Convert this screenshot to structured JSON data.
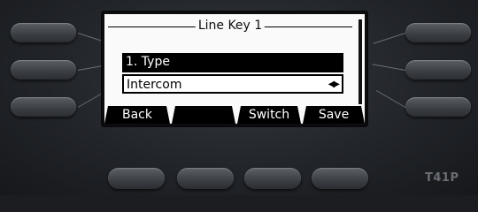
{
  "screen": {
    "title": "Line Key 1",
    "field_label": "1. Type",
    "field_value": "Intercom",
    "value_arrows": "◀▶"
  },
  "softkeys": [
    {
      "label": "Back"
    },
    {
      "label": ""
    },
    {
      "label": "Switch"
    },
    {
      "label": "Save"
    }
  ],
  "device": {
    "model": "T41P"
  }
}
